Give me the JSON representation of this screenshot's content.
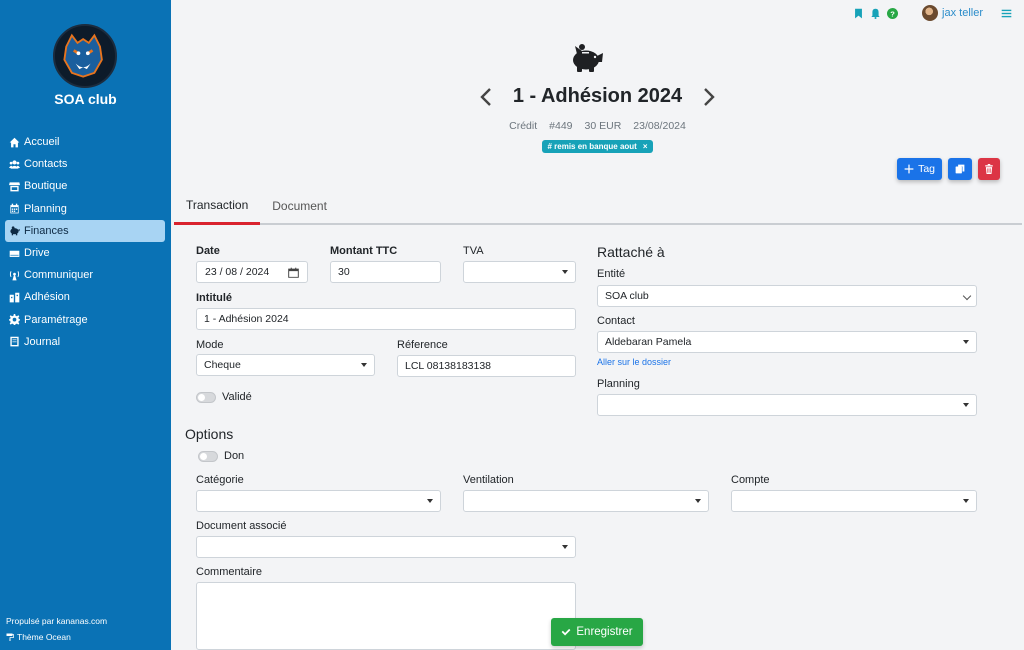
{
  "sidebar": {
    "club_name": "SOA club",
    "items": [
      {
        "label": "Accueil",
        "icon": "home-icon"
      },
      {
        "label": "Contacts",
        "icon": "users-icon"
      },
      {
        "label": "Boutique",
        "icon": "store-icon"
      },
      {
        "label": "Planning",
        "icon": "calendar-icon"
      },
      {
        "label": "Finances",
        "icon": "piggy-bank-icon"
      },
      {
        "label": "Drive",
        "icon": "drive-icon"
      },
      {
        "label": "Communiquer",
        "icon": "broadcast-icon"
      },
      {
        "label": "Adhésion",
        "icon": "membership-icon"
      },
      {
        "label": "Paramétrage",
        "icon": "gear-icon"
      },
      {
        "label": "Journal",
        "icon": "book-icon"
      }
    ],
    "active_item": "Finances",
    "powered_by": "Propulsé par kananas.com",
    "theme": "Thème Ocean"
  },
  "topbar": {
    "user_name": "jax teller",
    "icons": [
      "bookmark-icon",
      "bell-icon",
      "help-icon",
      "menu-icon"
    ]
  },
  "header": {
    "title": "1 - Adhésion 2024",
    "type": "Crédit",
    "number": "#449",
    "amount": "30 EUR",
    "date": "23/08/2024",
    "tag": "# remis en banque aout",
    "tag_close": "×",
    "icon": "piggy-bank-icon"
  },
  "actions": {
    "tag_label": "Tag"
  },
  "tabs": [
    {
      "label": "Transaction",
      "active": true
    },
    {
      "label": "Document",
      "active": false
    }
  ],
  "form": {
    "date_label": "Date",
    "date_value": "23 / 08 / 2024",
    "montant_label": "Montant TTC",
    "montant_value": "30",
    "tva_label": "TVA",
    "tva_value": "",
    "intitule_label": "Intitulé",
    "intitule_value": "1 - Adhésion 2024",
    "mode_label": "Mode",
    "mode_value": "Cheque",
    "reference_label": "Réference",
    "reference_value": "LCL 08138183138",
    "valide_label": "Validé",
    "rattache_title": "Rattaché à",
    "entite_label": "Entité",
    "entite_value": "SOA club",
    "contact_label": "Contact",
    "contact_value": "Aldebaran Pamela",
    "dossier_link": "Aller sur le dossier",
    "planning_label": "Planning",
    "planning_value": "",
    "options_title": "Options",
    "don_label": "Don",
    "categorie_label": "Catégorie",
    "ventilation_label": "Ventilation",
    "compte_label": "Compte",
    "document_label": "Document associé",
    "commentaire_label": "Commentaire"
  },
  "save_label": "Enregistrer",
  "colors": {
    "sidebar": "#0a72b5",
    "active_item": "#a8d4f3",
    "primary": "#1a73e8",
    "danger": "#dc3545",
    "success": "#28a745",
    "badge": "#17a2b8",
    "tab_underline": "#d9232e"
  }
}
